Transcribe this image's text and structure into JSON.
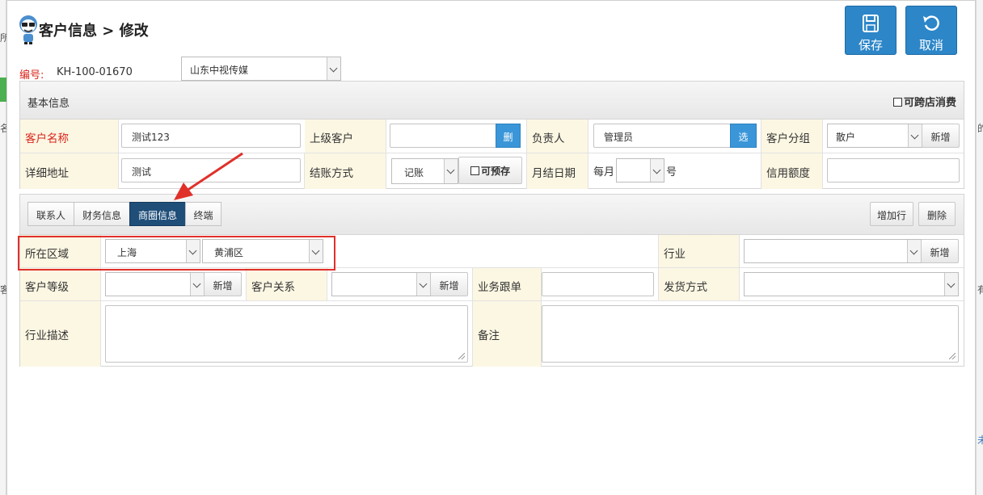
{
  "header": {
    "title": "客户信息 > 修改",
    "save_label": "保存",
    "cancel_label": "取消"
  },
  "record": {
    "code_label": "编号:",
    "code_value": "KH-100-01670",
    "company": "山东中视传媒"
  },
  "basic": {
    "title": "基本信息",
    "cross_store_label": "可跨店消费",
    "customer_name_label": "客户名称",
    "customer_name_value": "测试123",
    "parent_label": "上级客户",
    "parent_btn": "删",
    "owner_label": "负责人",
    "owner_value": "管理员",
    "owner_btn": "选",
    "group_label": "客户分组",
    "group_value": "散户",
    "group_add": "新增",
    "address_label": "详细地址",
    "address_value": "测试",
    "settle_label": "结账方式",
    "settle_value": "记账",
    "prestore_label": "可预存",
    "monthly_label": "月结日期",
    "monthly_prefix": "每月",
    "monthly_suffix": "号",
    "credit_label": "信用额度"
  },
  "tabs": [
    "联系人",
    "财务信息",
    "商圈信息",
    "终端"
  ],
  "actions": {
    "add_row": "增加行",
    "delete": "删除"
  },
  "biz": {
    "region_label": "所在区域",
    "region_city": "上海",
    "region_district": "黄浦区",
    "industry_label": "行业",
    "industry_add": "新增",
    "level_label": "客户等级",
    "level_add": "新增",
    "relation_label": "客户关系",
    "relation_add": "新增",
    "followup_label": "业务跟单",
    "shipping_label": "发货方式",
    "industry_desc_label": "行业描述",
    "remark_label": "备注"
  },
  "bg_fragments": [
    "所",
    "名",
    "的",
    "客",
    "有",
    "未"
  ],
  "colors": {
    "primary": "#2c86c8",
    "label_bg": "#fcf7e3",
    "required": "#d9261c",
    "highlight": "#e0302a",
    "active_tab": "#1f4e79"
  }
}
